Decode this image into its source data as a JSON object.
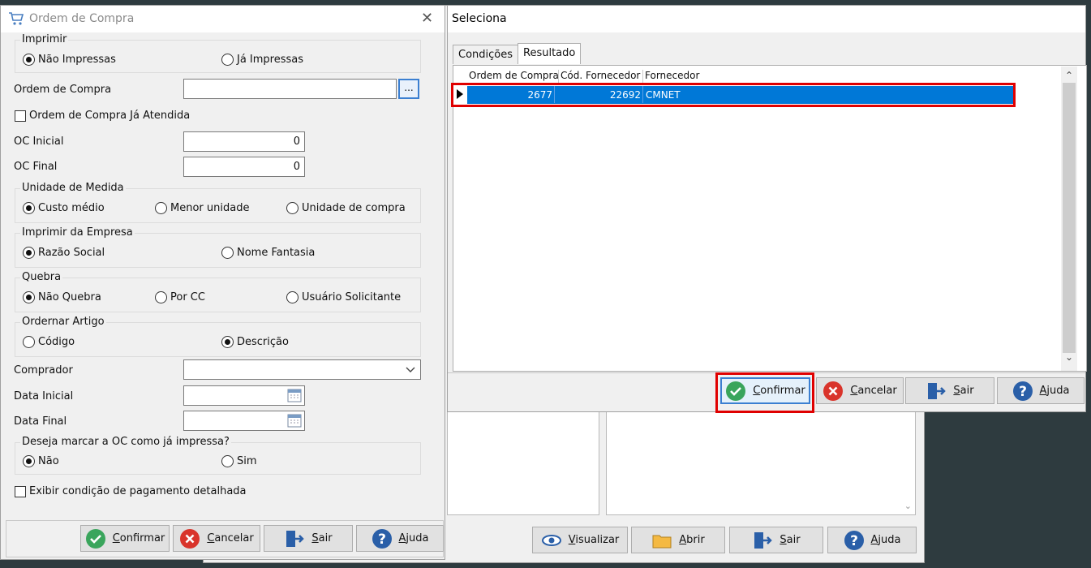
{
  "ordem_dialog": {
    "title": "Ordem de Compra",
    "imprimir": {
      "legend": "Imprimir",
      "opt1": "Não Impressas",
      "opt2": "Já Impressas"
    },
    "ordem_compra_label": "Ordem de Compra",
    "lookup_btn": "...",
    "ja_atendida_label": "Ordem de Compra Já Atendida",
    "oc_inicial_label": "OC Inicial",
    "oc_inicial_value": "0",
    "oc_final_label": "OC Final",
    "oc_final_value": "0",
    "unidade": {
      "legend": "Unidade de Medida",
      "opt1": "Custo médio",
      "opt2": "Menor unidade",
      "opt3": "Unidade de compra"
    },
    "empresa": {
      "legend": "Imprimir da Empresa",
      "opt1": "Razão Social",
      "opt2": "Nome Fantasia"
    },
    "quebra": {
      "legend": "Quebra",
      "opt1": "Não Quebra",
      "opt2": "Por CC",
      "opt3": "Usuário Solicitante"
    },
    "ordenar": {
      "legend": "Ordernar Artigo",
      "opt1": "Código",
      "opt2": "Descrição"
    },
    "comprador_label": "Comprador",
    "data_inicial_label": "Data Inicial",
    "data_final_label": "Data Final",
    "marcar": {
      "legend": "Deseja marcar a OC como já impressa?",
      "opt1": "Não",
      "opt2": "Sim"
    },
    "exibir_label": "Exibir condição de pagamento detalhada",
    "buttons": {
      "confirmar": "Confirmar",
      "cancelar": "Cancelar",
      "sair": "Sair",
      "ajuda": "Ajuda"
    }
  },
  "seleciona_dialog": {
    "title": "Seleciona",
    "tabs": [
      "Condições",
      "Resultado"
    ],
    "columns": [
      "Ordem de Compra",
      "Cód. Fornecedor",
      "Fornecedor"
    ],
    "rows": [
      {
        "ordem": "2677",
        "cod": "22692",
        "fornecedor": "CMNET"
      }
    ],
    "buttons": {
      "confirmar": "Confirmar",
      "cancelar": "Cancelar",
      "sair": "Sair",
      "ajuda": "Ajuda"
    }
  },
  "background_window": {
    "buttons": {
      "visualizar": "Visualizar",
      "abrir": "Abrir",
      "sair": "Sair",
      "ajuda": "Ajuda"
    }
  },
  "colors": {
    "selection": "#0078d7",
    "highlight": "#e00000",
    "confirm_green": "#3aa55c",
    "cancel_red": "#d9342b",
    "help_blue": "#2a5fa8"
  }
}
